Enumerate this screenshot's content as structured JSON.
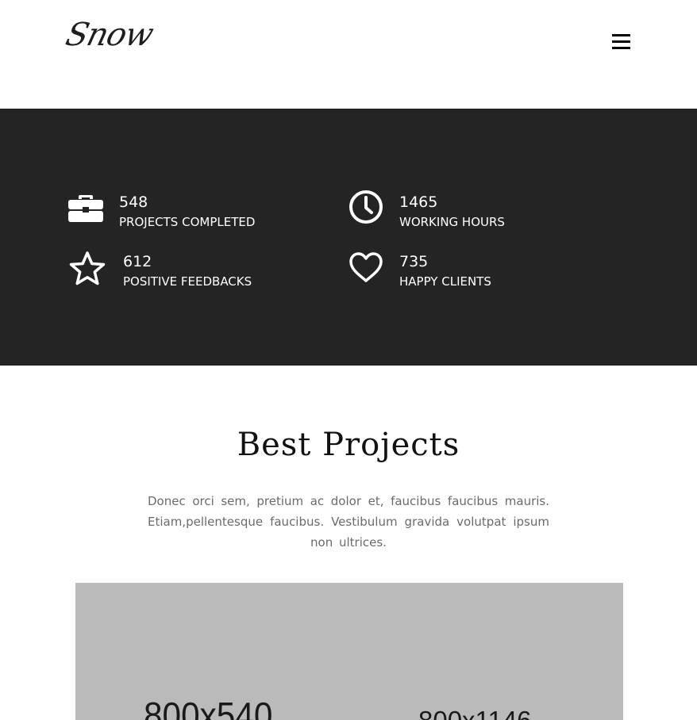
{
  "header": {
    "logo_text": "Snow",
    "menu_icon": "hamburger-menu-icon"
  },
  "stats": [
    {
      "icon": "briefcase-icon",
      "value": "548",
      "label": "PROJECTS COMPLETED"
    },
    {
      "icon": "clock-icon",
      "value": "1465",
      "label": "WORKING HOURS"
    },
    {
      "icon": "star-icon",
      "value": "612",
      "label": "POSITIVE FEEDBACKS"
    },
    {
      "icon": "heart-icon",
      "value": "735",
      "label": "HAPPY CLIENTS"
    }
  ],
  "projects": {
    "title": "Best Projects",
    "description": "Donec orci sem, pretium ac dolor et, faucibus faucibus mauris. Etiam,pellentesque faucibus. Vestibulum gravida volutpat ipsum non ultrices.",
    "images": [
      {
        "placeholder": "800x540"
      },
      {
        "placeholder": "800x1146"
      }
    ]
  },
  "colors": {
    "stats_background": "#242424",
    "image_placeholder": "#bababa",
    "text_dark": "#111111",
    "text_muted": "#6b6b6b"
  }
}
